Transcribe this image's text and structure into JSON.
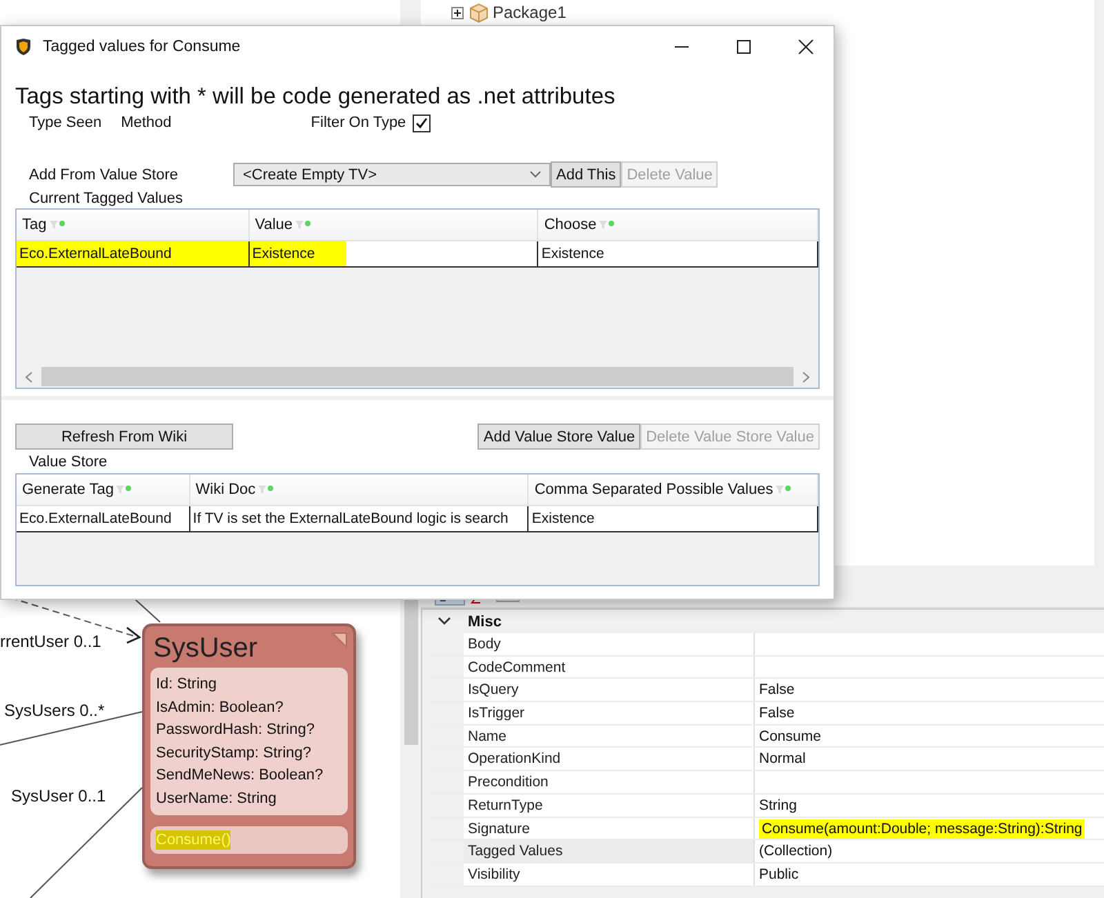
{
  "dialog": {
    "title": "Tagged values for Consume",
    "heading": "Tags starting with * will be code generated as .net attributes",
    "type_seen": {
      "label": "Type Seen",
      "value": "Method"
    },
    "filter_on_type": {
      "label": "Filter On Type",
      "checked": true
    },
    "add_from_value_store": {
      "label": "Add From Value Store",
      "value": "<Create Empty TV>"
    },
    "add_buttons": [
      {
        "label": "Add This",
        "disabled": false
      },
      {
        "label": "Delete Value",
        "disabled": true
      }
    ],
    "current_tagged_values": {
      "label": "Current Tagged Values",
      "columns": [
        "Tag",
        "Value",
        "Choose"
      ],
      "rows": [
        {
          "cells": [
            "Eco.ExternalLateBound",
            "Existence",
            "Existence"
          ],
          "highlighted": true
        }
      ]
    },
    "refresh_button": {
      "label": "Refresh From Wiki",
      "disabled": false
    },
    "value_store_buttons": [
      {
        "label": "Add Value Store Value",
        "disabled": false
      },
      {
        "label": "Delete Value Store Value",
        "disabled": true
      }
    ],
    "value_store": {
      "label": "Value Store",
      "columns": [
        "Generate Tag",
        "Wiki Doc",
        "Comma Separated Possible Values"
      ],
      "rows": [
        {
          "cells": [
            "Eco.ExternalLateBound",
            "If TV is set the ExternalLateBound logic is search",
            "Existence"
          ],
          "highlighted": false
        }
      ]
    }
  },
  "diagram": {
    "class": {
      "name": "SysUser",
      "attributes": [
        "Id: String",
        "IsAdmin: Boolean?",
        "PasswordHash: String?",
        "SecurityStamp: String?",
        "SendMeNews: Boolean?",
        "UserName: String"
      ],
      "methods": [
        {
          "name": "Consume()",
          "highlighted": true
        }
      ]
    },
    "association_labels": [
      "rrentUser 0..1",
      "SysUsers 0..*",
      "SysUser 0..1"
    ]
  },
  "model_tree": {
    "items": [
      {
        "label": "Package1",
        "expanded": false
      }
    ]
  },
  "property_grid": {
    "category": {
      "label": "Misc",
      "expanded": true
    },
    "rows": [
      {
        "name": "Body",
        "value": "",
        "highlighted": false,
        "selected": false
      },
      {
        "name": "CodeComment",
        "value": "",
        "highlighted": false,
        "selected": false
      },
      {
        "name": "IsQuery",
        "value": "False",
        "highlighted": false,
        "selected": false
      },
      {
        "name": "IsTrigger",
        "value": "False",
        "highlighted": false,
        "selected": false
      },
      {
        "name": "Name",
        "value": "Consume",
        "highlighted": false,
        "selected": false
      },
      {
        "name": "OperationKind",
        "value": "Normal",
        "highlighted": false,
        "selected": false
      },
      {
        "name": "Precondition",
        "value": "",
        "highlighted": false,
        "selected": false
      },
      {
        "name": "ReturnType",
        "value": "String",
        "highlighted": false,
        "selected": false
      },
      {
        "name": "Signature",
        "value": "Consume(amount:Double; message:String):String",
        "highlighted": true,
        "selected": false
      },
      {
        "name": "Tagged Values",
        "value": "(Collection)",
        "highlighted": false,
        "selected": true
      },
      {
        "name": "Visibility",
        "value": "Public",
        "highlighted": false,
        "selected": false
      }
    ]
  }
}
